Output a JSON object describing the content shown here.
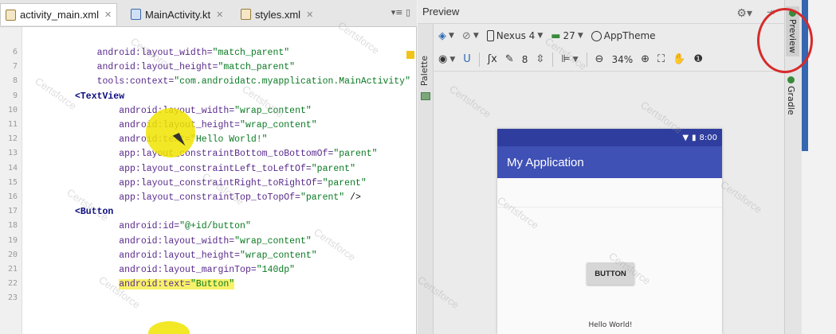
{
  "tabs": [
    {
      "label": "activity_main.xml",
      "active": true,
      "icon": "xml-file-icon"
    },
    {
      "label": "MainActivity.kt",
      "active": false,
      "icon": "kotlin-file-icon"
    },
    {
      "label": "styles.xml",
      "active": false,
      "icon": "xml-file-icon"
    }
  ],
  "editor": {
    "line_numbers": [
      "6",
      "7",
      "8",
      "9",
      "10",
      "11",
      "12",
      "13",
      "14",
      "15",
      "16",
      "17",
      "18",
      "19",
      "20",
      "21",
      "22",
      "23"
    ],
    "lines": [
      {
        "indent": "    ",
        "attr": "android:layout_width=",
        "str": "\"match_parent\""
      },
      {
        "indent": "    ",
        "attr": "android:layout_height=",
        "str": "\"match_parent\""
      },
      {
        "indent": "    ",
        "attr": "tools:context=",
        "str": "\"com.androidatc.myapplication.MainActivity\""
      },
      {
        "indent": "",
        "tag": "<TextView"
      },
      {
        "indent": "        ",
        "attr": "android:layout_width=",
        "str": "\"wrap_content\""
      },
      {
        "indent": "        ",
        "attr": "android:layout_height=",
        "str": "\"wrap_content\""
      },
      {
        "indent": "        ",
        "attr": "android:text=",
        "str": "\"Hello World!\""
      },
      {
        "indent": "        ",
        "attr": "app:layout_constraintBottom_toBottomOf=",
        "str": "\"parent\""
      },
      {
        "indent": "        ",
        "attr": "app:layout_constraintLeft_toLeftOf=",
        "str": "\"parent\""
      },
      {
        "indent": "        ",
        "attr": "app:layout_constraintRight_toRightOf=",
        "str": "\"parent\""
      },
      {
        "indent": "        ",
        "attr": "app:layout_constraintTop_toTopOf=",
        "str": "\"parent\"",
        "tail": " />"
      },
      {
        "indent": "",
        "tag": "<Button"
      },
      {
        "indent": "        ",
        "attr": "android:id=",
        "str": "\"@+id/button\""
      },
      {
        "indent": "        ",
        "attr": "android:layout_width=",
        "str": "\"wrap_content\""
      },
      {
        "indent": "        ",
        "attr": "android:layout_height=",
        "str": "\"wrap_content\""
      },
      {
        "indent": "        ",
        "attr": "android:layout_marginTop=",
        "str": "\"140dp\""
      },
      {
        "indent": "        ",
        "attr": "android:text=",
        "str": "\"Button\"",
        "highlight": true
      }
    ]
  },
  "preview": {
    "title": "Preview",
    "palette_label": "Palette",
    "device": "Nexus 4",
    "api_level": "27",
    "theme": "AppTheme",
    "font_size": "8",
    "zoom": "34%",
    "app_title": "My Application",
    "status_time": "8:00",
    "button_text": "BUTTON",
    "hello_text": "Hello World!"
  },
  "right_panel": {
    "preview_tab": "Preview",
    "gradle_tab": "Gradle"
  },
  "watermark": "Certsforce",
  "colors": {
    "app_bar": "#3f51b5",
    "status_bar": "#2f3e9e",
    "highlight_circle": "#d62b2b",
    "cursor_highlight": "#f0e400"
  }
}
